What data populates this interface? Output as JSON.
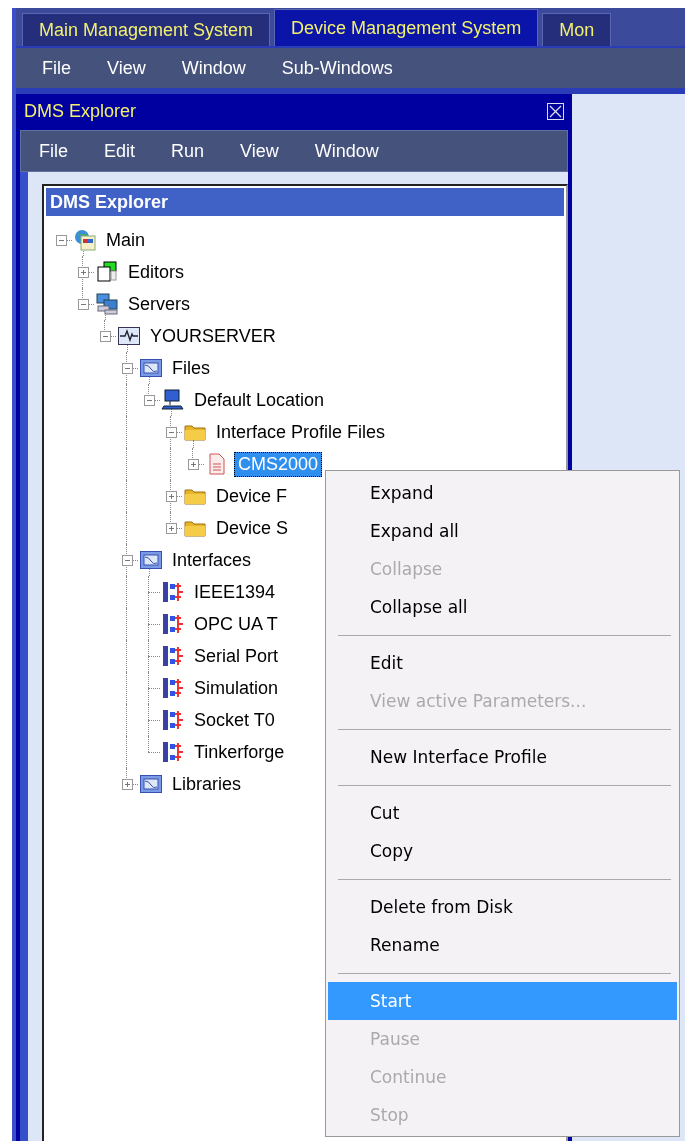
{
  "tabs": [
    {
      "label": "Main Management System",
      "selected": false
    },
    {
      "label": "Device Management System",
      "selected": true
    },
    {
      "label": "Mon",
      "selected": false
    }
  ],
  "menu_bar": [
    "File",
    "View",
    "Window",
    "Sub-Windows"
  ],
  "panel": {
    "title": "DMS Explorer",
    "menu": [
      "File",
      "Edit",
      "Run",
      "View",
      "Window"
    ],
    "tree": {
      "header": "DMS Explorer",
      "nodes": [
        {
          "label": "Main",
          "kind": "home",
          "expanded": true,
          "selected": false,
          "children": [
            {
              "label": "Editors",
              "kind": "editors",
              "expanded": false,
              "selected": false
            },
            {
              "label": "Servers",
              "kind": "servers",
              "expanded": true,
              "selected": false,
              "children": [
                {
                  "label": "YOURSERVER",
                  "kind": "monitor",
                  "expanded": true,
                  "selected": false,
                  "children": [
                    {
                      "label": "Files",
                      "kind": "chart",
                      "expanded": true,
                      "selected": false,
                      "children": [
                        {
                          "label": "Default Location",
                          "kind": "computer",
                          "expanded": true,
                          "selected": false,
                          "children": [
                            {
                              "label": "Interface Profile Files",
                              "kind": "folder",
                              "expanded": true,
                              "selected": false,
                              "children": [
                                {
                                  "label": "CMS2000",
                                  "kind": "document",
                                  "expanded": false,
                                  "selected": true
                                }
                              ]
                            },
                            {
                              "label": "Device F",
                              "kind": "folder",
                              "expanded": false,
                              "selected": false
                            },
                            {
                              "label": "Device S",
                              "kind": "folder",
                              "expanded": false,
                              "selected": false
                            }
                          ]
                        }
                      ]
                    },
                    {
                      "label": "Interfaces",
                      "kind": "chart",
                      "expanded": true,
                      "selected": false,
                      "children": [
                        {
                          "label": "IEEE1394",
                          "kind": "interface",
                          "selected": false
                        },
                        {
                          "label": "OPC UA T",
                          "kind": "interface",
                          "selected": false
                        },
                        {
                          "label": "Serial Port",
                          "kind": "interface",
                          "selected": false
                        },
                        {
                          "label": "Simulation",
                          "kind": "interface",
                          "selected": false
                        },
                        {
                          "label": "Socket T0",
                          "kind": "interface",
                          "selected": false
                        },
                        {
                          "label": "Tinkerforge",
                          "kind": "interface",
                          "selected": false
                        }
                      ]
                    },
                    {
                      "label": "Libraries",
                      "kind": "chart",
                      "expanded": false,
                      "selected": false
                    }
                  ]
                }
              ]
            }
          ]
        }
      ]
    }
  },
  "context_menu": {
    "items": [
      {
        "kind": "item",
        "label": "Expand",
        "disabled": false,
        "selected": false
      },
      {
        "kind": "item",
        "label": "Expand all",
        "disabled": false,
        "selected": false
      },
      {
        "kind": "item",
        "label": "Collapse",
        "disabled": true,
        "selected": false
      },
      {
        "kind": "item",
        "label": "Collapse all",
        "disabled": false,
        "selected": false
      },
      {
        "kind": "separator"
      },
      {
        "kind": "item",
        "label": "Edit",
        "disabled": false,
        "selected": false
      },
      {
        "kind": "item",
        "label": "View active Parameters...",
        "disabled": true,
        "selected": false
      },
      {
        "kind": "separator"
      },
      {
        "kind": "item",
        "label": "New Interface Profile",
        "disabled": false,
        "selected": false
      },
      {
        "kind": "separator"
      },
      {
        "kind": "item",
        "label": "Cut",
        "disabled": false,
        "selected": false
      },
      {
        "kind": "item",
        "label": "Copy",
        "disabled": false,
        "selected": false
      },
      {
        "kind": "separator"
      },
      {
        "kind": "item",
        "label": "Delete from Disk",
        "disabled": false,
        "selected": false
      },
      {
        "kind": "item",
        "label": "Rename",
        "disabled": false,
        "selected": false
      },
      {
        "kind": "separator"
      },
      {
        "kind": "item",
        "label": "Start",
        "disabled": false,
        "selected": true
      },
      {
        "kind": "item",
        "label": "Pause",
        "disabled": true,
        "selected": false
      },
      {
        "kind": "item",
        "label": "Continue",
        "disabled": true,
        "selected": false
      },
      {
        "kind": "item",
        "label": "Stop",
        "disabled": true,
        "selected": false
      }
    ]
  }
}
